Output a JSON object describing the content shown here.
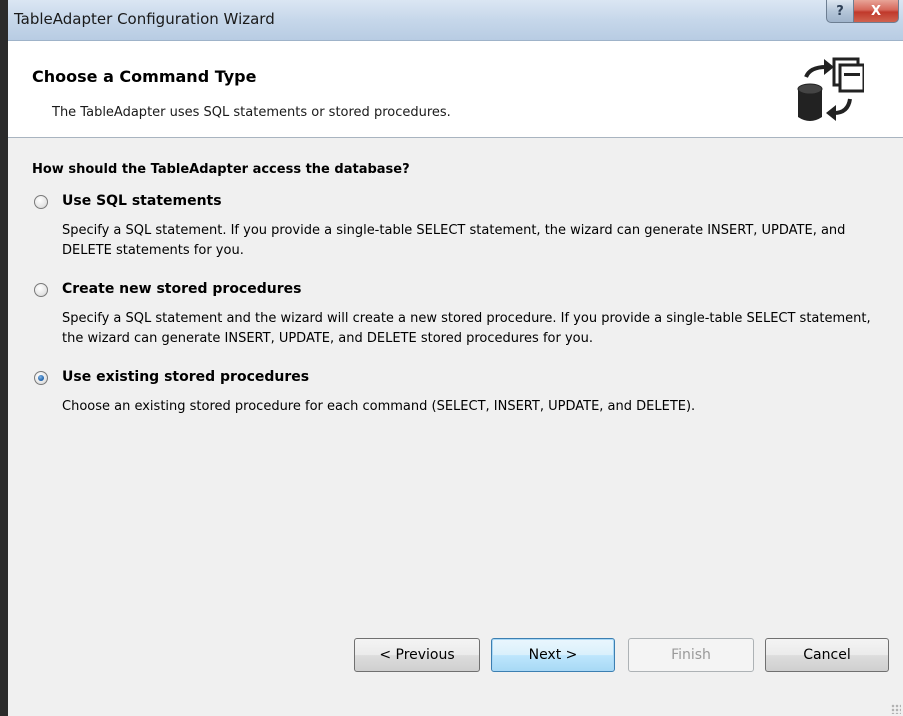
{
  "window": {
    "title": "TableAdapter Configuration Wizard",
    "help_glyph": "?",
    "close_glyph": "X"
  },
  "header": {
    "title": "Choose a Command Type",
    "subtitle": "The TableAdapter uses SQL statements or stored procedures.",
    "icon": "database-command-icon"
  },
  "main": {
    "question": "How should the TableAdapter access the database?",
    "options": [
      {
        "label": "Use SQL statements",
        "description": "Specify a SQL statement. If you provide a single-table SELECT statement, the wizard can generate INSERT, UPDATE, and DELETE statements for you.",
        "selected": false
      },
      {
        "label": "Create new stored procedures",
        "description": "Specify a SQL statement and the wizard will create a new stored procedure. If you provide a single-table SELECT statement, the wizard can generate INSERT, UPDATE, and DELETE stored procedures for you.",
        "selected": false
      },
      {
        "label": "Use existing stored procedures",
        "description": "Choose an existing stored procedure for each command (SELECT, INSERT, UPDATE, and DELETE).",
        "selected": true
      }
    ]
  },
  "footer": {
    "previous_label": "< Previous",
    "next_label": "Next >",
    "finish_label": "Finish",
    "cancel_label": "Cancel"
  },
  "colors": {
    "titlebar": "#c6d7ea",
    "close_button": "#c0392b",
    "content_bg": "#f0f0f0",
    "default_button_border": "#3c7fb1"
  }
}
